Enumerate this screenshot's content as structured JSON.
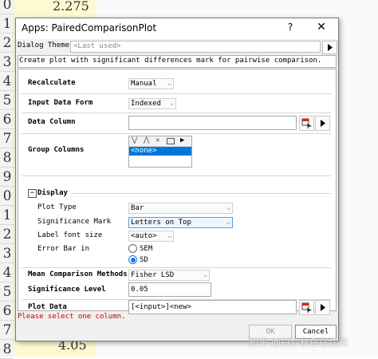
{
  "sheet": {
    "row_numbers": [
      "0",
      "1",
      "2",
      "3",
      "4",
      "5",
      "6",
      "7",
      "8",
      "9",
      "0",
      "1",
      "2",
      "3",
      "4",
      "5",
      "6",
      "7",
      "8"
    ],
    "top_value": "2.275",
    "bottom_value": "4.05"
  },
  "dialog": {
    "title": "Apps: PairedComparisonPlot",
    "help_label": "?",
    "close_label": "✕",
    "theme_label": "Dialog Theme",
    "theme_value": "<Last used>",
    "description": "Create plot with significant differences mark for pairwise comparison."
  },
  "form": {
    "recalculate": {
      "label": "Recalculate",
      "value": "Manual"
    },
    "input_data_form": {
      "label": "Input Data Form",
      "value": "Indexed"
    },
    "data_column": {
      "label": "Data Column",
      "value": ""
    },
    "group_columns": {
      "label": "Group Columns",
      "list_item": "<none>"
    },
    "display": {
      "toggle": "−",
      "label": "Display",
      "plot_type": {
        "label": "Plot Type",
        "value": "Bar"
      },
      "significance_mark": {
        "label": "Significance Mark",
        "value": "Letters on Top"
      },
      "label_font_size": {
        "label": "Label font size",
        "value": "<auto>"
      },
      "error_bar": {
        "label": "Error Bar in",
        "options": [
          "SEM",
          "SD"
        ],
        "selected": "SD"
      }
    },
    "mean_comparison": {
      "label": "Mean Comparison Methods",
      "value": "Fisher LSD"
    },
    "significance_level": {
      "label": "Significance Level",
      "value": "0.05"
    },
    "plot_data": {
      "label": "Plot Data",
      "value": "[<input>]<new>"
    }
  },
  "status": "Please select one column.",
  "buttons": {
    "ok": "OK",
    "cancel": "Cancel"
  },
  "watermark": "知乎 @白沙秋色在江湖",
  "colors": {
    "status": "#c00000",
    "radio_selected": "#1a73e8",
    "list_selection": "#0078d7"
  }
}
